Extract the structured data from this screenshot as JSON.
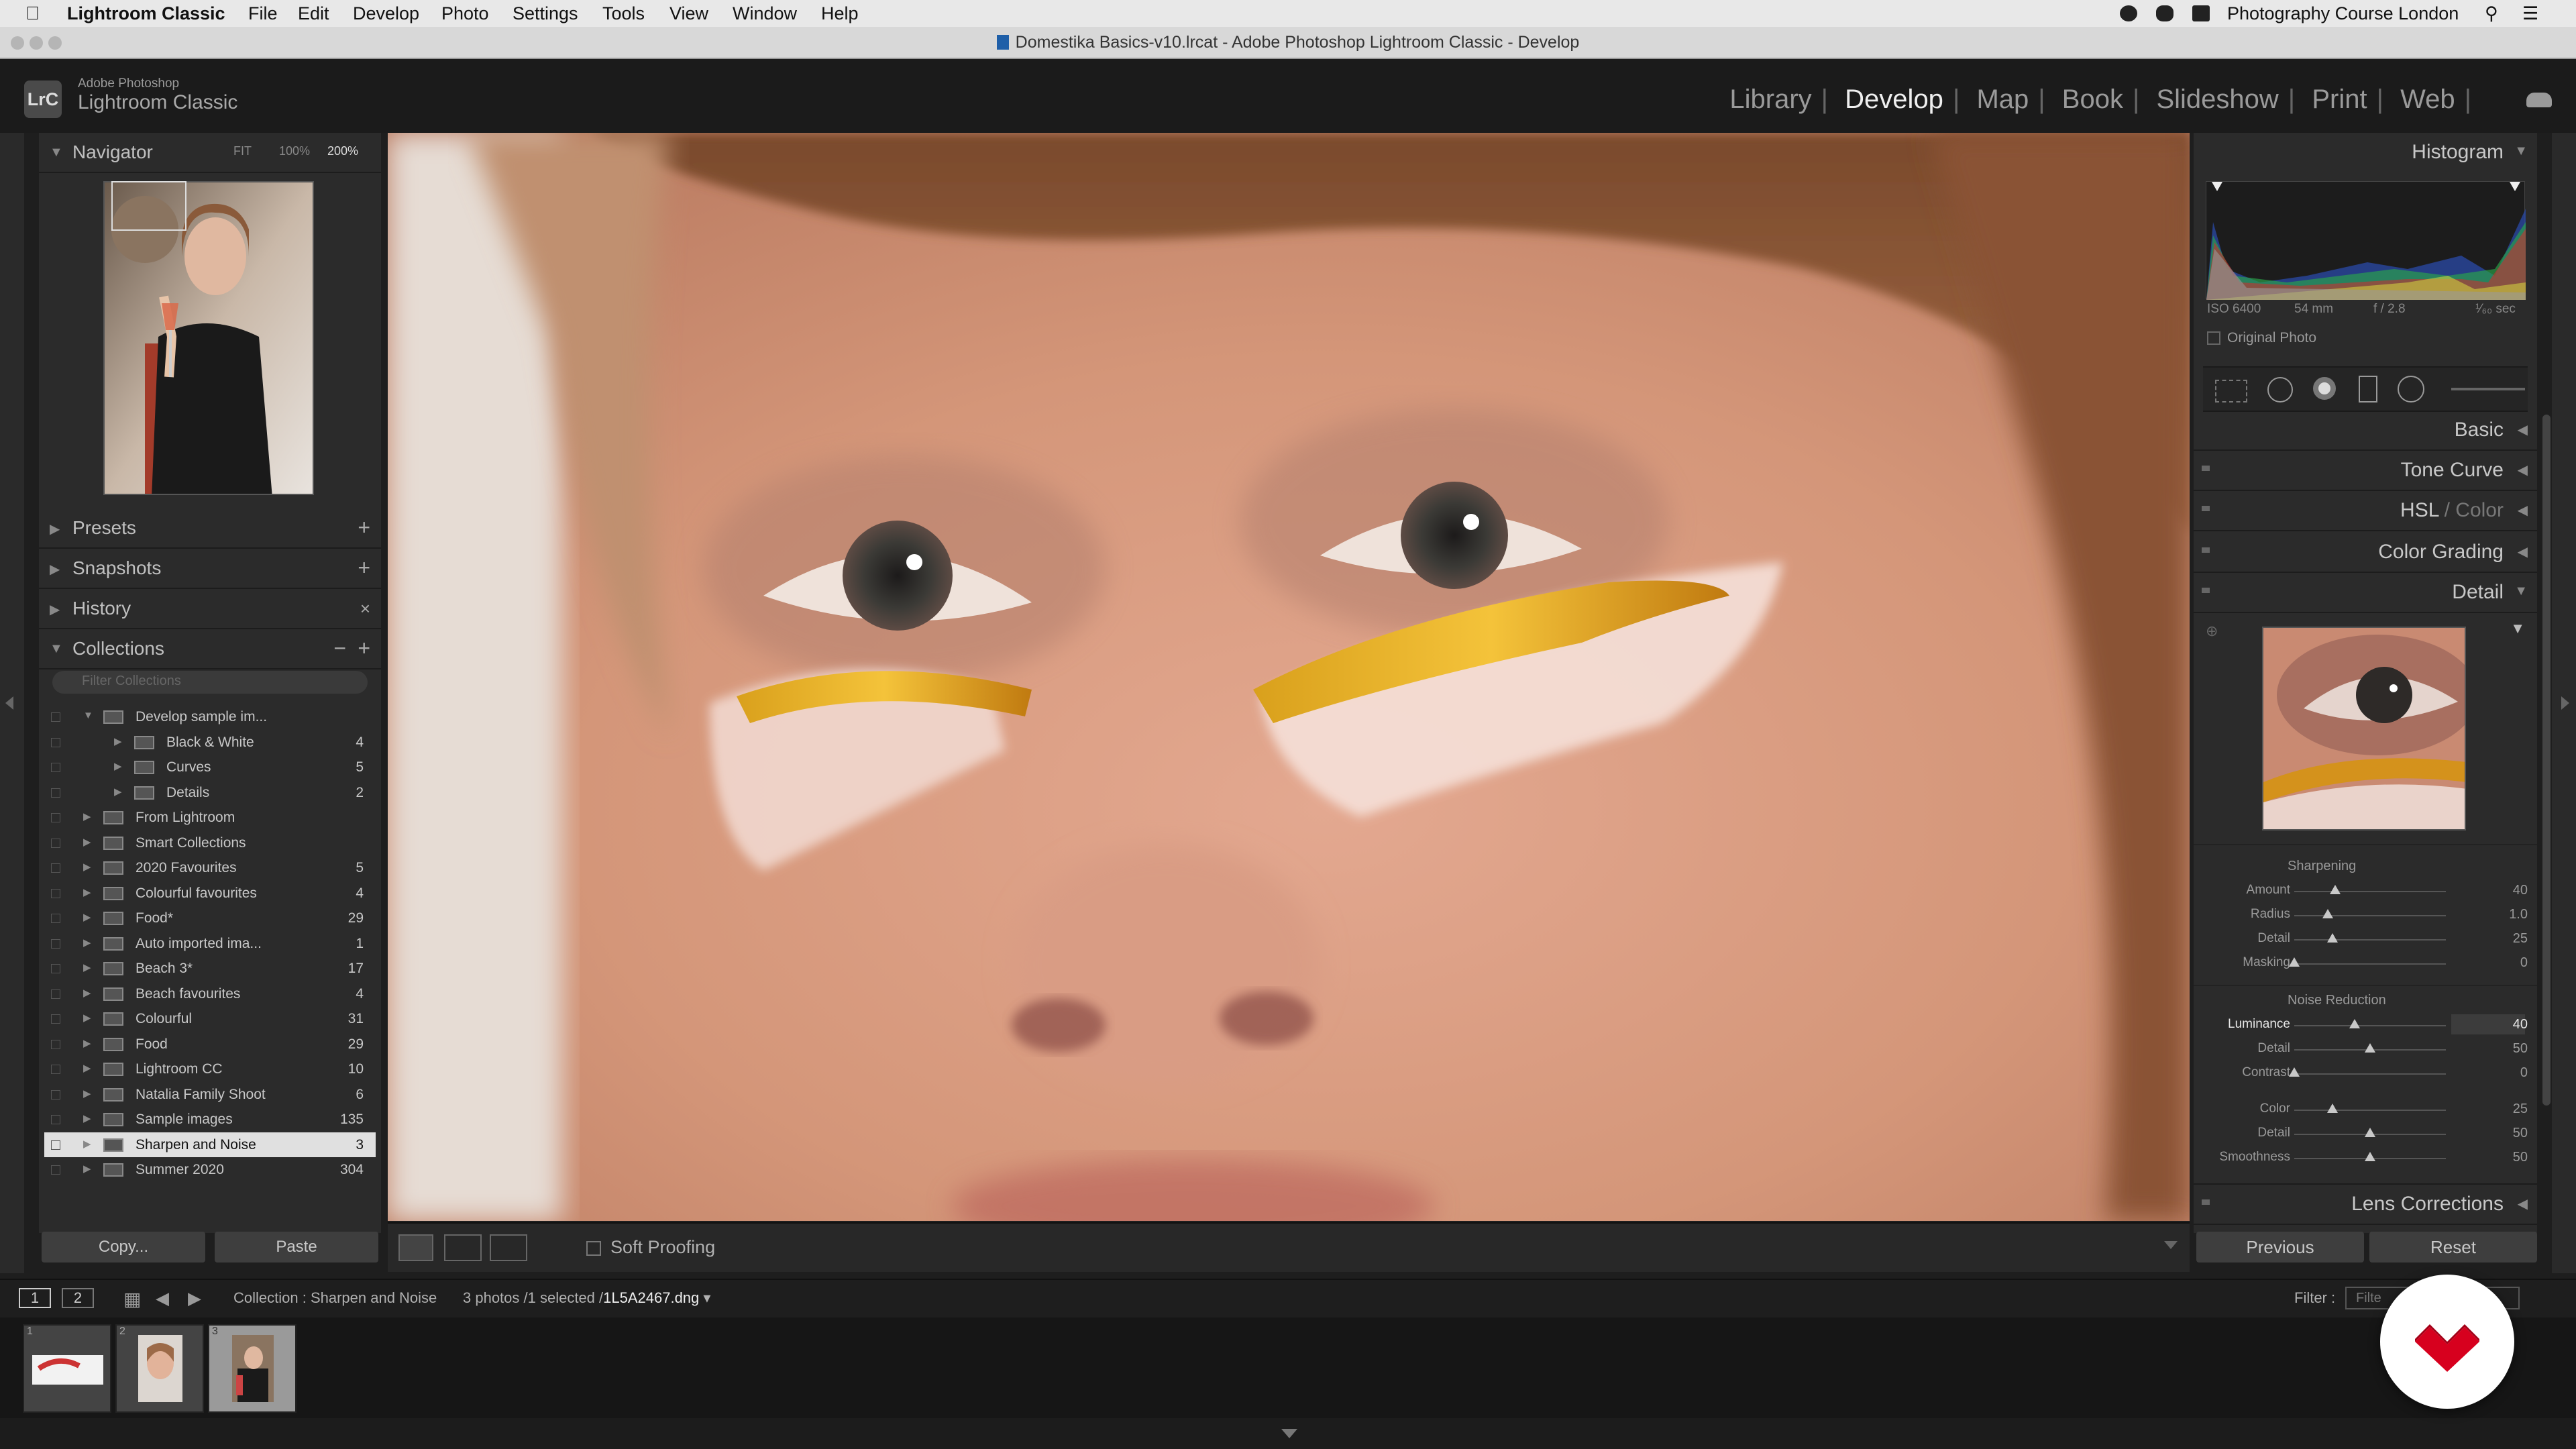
{
  "menubar": {
    "app_name": "Lightroom Classic",
    "items": [
      "File",
      "Edit",
      "Develop",
      "Photo",
      "Settings",
      "Tools",
      "View",
      "Window",
      "Help"
    ],
    "right_label": "Photography Course London"
  },
  "window": {
    "title": "Domestika Basics-v10.lrcat - Adobe Photoshop Lightroom Classic - Develop"
  },
  "brand": {
    "logo": "LrC",
    "small": "Adobe Photoshop",
    "name": "Lightroom Classic"
  },
  "modules": {
    "items": [
      "Library",
      "Develop",
      "Map",
      "Book",
      "Slideshow",
      "Print",
      "Web"
    ],
    "active": "Develop"
  },
  "left_panel": {
    "navigator": {
      "title": "Navigator",
      "zoom": [
        "FIT",
        "100%",
        "200%"
      ],
      "zoom_active": "200%"
    },
    "presets": "Presets",
    "snapshots": "Snapshots",
    "history": "History",
    "collections": {
      "title": "Collections",
      "filter_placeholder": "Filter Collections",
      "items": [
        {
          "name": "Develop sample im...",
          "count": "",
          "level": 0,
          "open": true
        },
        {
          "name": "Black & White",
          "count": "4",
          "level": 1
        },
        {
          "name": "Curves",
          "count": "5",
          "level": 1
        },
        {
          "name": "Details",
          "count": "2",
          "level": 1
        },
        {
          "name": "From Lightroom",
          "count": "",
          "level": 0
        },
        {
          "name": "Smart Collections",
          "count": "",
          "level": 0
        },
        {
          "name": "2020 Favourites",
          "count": "5",
          "level": 0
        },
        {
          "name": "Colourful favourites",
          "count": "4",
          "level": 0
        },
        {
          "name": "Food*",
          "count": "29",
          "level": 0
        },
        {
          "name": "Auto imported ima...",
          "count": "1",
          "level": 0
        },
        {
          "name": "Beach 3*",
          "count": "17",
          "level": 0
        },
        {
          "name": "Beach favourites",
          "count": "4",
          "level": 0
        },
        {
          "name": "Colourful",
          "count": "31",
          "level": 0
        },
        {
          "name": "Food",
          "count": "29",
          "level": 0
        },
        {
          "name": "Lightroom CC",
          "count": "10",
          "level": 0
        },
        {
          "name": "Natalia Family Shoot",
          "count": "6",
          "level": 0
        },
        {
          "name": "Sample images",
          "count": "135",
          "level": 0
        },
        {
          "name": "Sharpen and Noise",
          "count": "3",
          "level": 0,
          "selected": true
        },
        {
          "name": "Summer 2020",
          "count": "304",
          "level": 0
        }
      ]
    },
    "copy_label": "Copy...",
    "paste_label": "Paste"
  },
  "toolbar": {
    "soft_proofing": "Soft Proofing"
  },
  "right_panel": {
    "histogram": {
      "title": "Histogram",
      "iso": "ISO 6400",
      "focal": "54 mm",
      "aperture": "f / 2.8",
      "shutter": "¹⁄₆₀ sec",
      "original_photo": "Original Photo"
    },
    "sections": {
      "basic": "Basic",
      "tone_curve": "Tone Curve",
      "hsl": "HSL",
      "color": "Color",
      "color_grading": "Color Grading",
      "detail": "Detail",
      "lens_corrections": "Lens Corrections"
    },
    "sharpening": {
      "title": "Sharpening",
      "sliders": [
        {
          "label": "Amount",
          "value": "40",
          "pos": 0.27
        },
        {
          "label": "Radius",
          "value": "1.0",
          "pos": 0.22
        },
        {
          "label": "Detail",
          "value": "25",
          "pos": 0.25
        },
        {
          "label": "Masking",
          "value": "0",
          "pos": 0.0
        }
      ]
    },
    "noise_reduction": {
      "title": "Noise Reduction",
      "sliders": [
        {
          "label": "Luminance",
          "value": "40",
          "pos": 0.4,
          "active": true
        },
        {
          "label": "Detail",
          "value": "50",
          "pos": 0.5
        },
        {
          "label": "Contrast",
          "value": "0",
          "pos": 0.0
        },
        {
          "label": "Color",
          "value": "25",
          "pos": 0.25
        },
        {
          "label": "Detail",
          "value": "50",
          "pos": 0.5
        },
        {
          "label": "Smoothness",
          "value": "50",
          "pos": 0.5
        }
      ]
    },
    "previous_label": "Previous",
    "reset_label": "Reset"
  },
  "filmbar": {
    "page1": "1",
    "page2": "2",
    "collection": "Collection : Sharpen and Noise",
    "count": "3 photos /1 selected /",
    "file": "1L5A2467.dng",
    "filter_label": "Filter :",
    "filter_value": "Filte"
  },
  "filmstrip": {
    "numbers": [
      "1",
      "2",
      "3"
    ]
  },
  "colors": {
    "panel": "#2b2b2b",
    "background": "#1e1e1e",
    "text": "#b8b8b8",
    "domestika_red": "#d7001e"
  }
}
